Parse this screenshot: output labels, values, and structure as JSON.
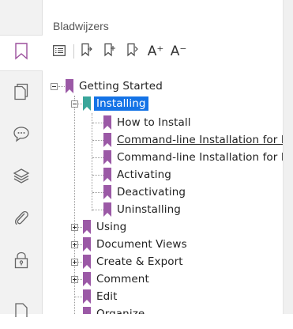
{
  "rail": {
    "items": [
      {
        "icon": "bookmark-icon"
      },
      {
        "icon": "pages-icon"
      },
      {
        "icon": "comment-icon"
      },
      {
        "icon": "layers-icon"
      },
      {
        "icon": "attachment-icon"
      },
      {
        "icon": "lock-icon"
      },
      {
        "icon": "document-icon"
      }
    ]
  },
  "panel": {
    "title": "Bladwijzers",
    "toolbar": [
      {
        "icon": "options-menu-icon"
      },
      {
        "icon": "new-bookmark-icon"
      },
      {
        "icon": "add-bookmark-icon"
      },
      {
        "icon": "expand-bookmark-icon"
      },
      {
        "icon": "increase-text-size-icon",
        "label": "A⁺"
      },
      {
        "icon": "decrease-text-size-icon",
        "label": "A⁻"
      }
    ]
  },
  "tree": {
    "root": "Getting Started",
    "installing": "Installing",
    "children": [
      "How to Install",
      "Command-line Installation for E",
      "Command-line Installation for N",
      "Activating",
      "Deactivating",
      "Uninstalling"
    ],
    "siblings": [
      "Using",
      "Document Views",
      "Create & Export",
      "Comment",
      "Edit",
      "Organize"
    ]
  },
  "colors": {
    "bookmark": "#9b59a6",
    "bookmark_selected": "#3aa69b",
    "selection": "#1473e6"
  }
}
